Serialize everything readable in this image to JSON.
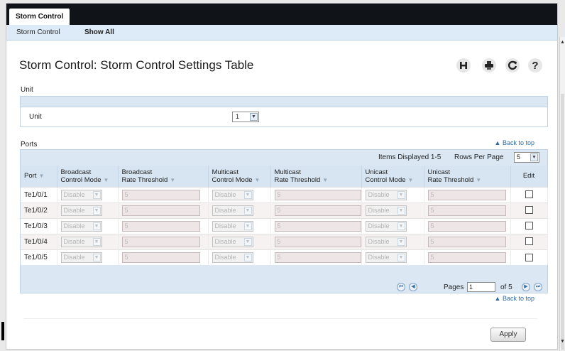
{
  "top_tab": "Storm Control",
  "subnav": {
    "items": [
      "Storm Control",
      "Show All"
    ]
  },
  "page_title": "Storm Control: Storm Control Settings Table",
  "icons": [
    "save-icon",
    "print-icon",
    "refresh-icon",
    "help-icon"
  ],
  "unit_section": {
    "label": "Unit",
    "row_label": "Unit",
    "selected": "1"
  },
  "ports_section": {
    "label": "Ports",
    "back_to_top": "Back to top",
    "items_displayed": "Items Displayed 1-5",
    "rows_per_page_label": "Rows Per Page",
    "rows_per_page": "5",
    "columns": {
      "port": "Port",
      "bc_mode": [
        "Broadcast",
        "Control Mode"
      ],
      "bc_rate": [
        "Broadcast",
        "Rate Threshold"
      ],
      "mc_mode": [
        "Multicast",
        "Control Mode"
      ],
      "mc_rate": [
        "Multicast",
        "Rate Threshold"
      ],
      "uc_mode": [
        "Unicast",
        "Control Mode"
      ],
      "uc_rate": [
        "Unicast",
        "Rate Threshold"
      ],
      "edit": "Edit"
    },
    "rows": [
      {
        "port": "Te1/0/1",
        "bc_mode": "Disable",
        "bc_rate": "5",
        "mc_mode": "Disable",
        "mc_rate": "5",
        "uc_mode": "Disable",
        "uc_rate": "5",
        "edit": false
      },
      {
        "port": "Te1/0/2",
        "bc_mode": "Disable",
        "bc_rate": "5",
        "mc_mode": "Disable",
        "mc_rate": "5",
        "uc_mode": "Disable",
        "uc_rate": "5",
        "edit": false
      },
      {
        "port": "Te1/0/3",
        "bc_mode": "Disable",
        "bc_rate": "5",
        "mc_mode": "Disable",
        "mc_rate": "5",
        "uc_mode": "Disable",
        "uc_rate": "5",
        "edit": false
      },
      {
        "port": "Te1/0/4",
        "bc_mode": "Disable",
        "bc_rate": "5",
        "mc_mode": "Disable",
        "mc_rate": "5",
        "uc_mode": "Disable",
        "uc_rate": "5",
        "edit": false
      },
      {
        "port": "Te1/0/5",
        "bc_mode": "Disable",
        "bc_rate": "5",
        "mc_mode": "Disable",
        "mc_rate": "5",
        "uc_mode": "Disable",
        "uc_rate": "5",
        "edit": false
      }
    ],
    "pager": {
      "pages_label": "Pages",
      "current_page": "1",
      "of_text": "of 5"
    }
  },
  "bottom_back_to_top": "Back to top",
  "apply_label": "Apply",
  "colors": {
    "tabbar": "#101418",
    "subnav": "#dcebf7",
    "table_header": "#d6e5f1",
    "link": "#2d6aa3"
  }
}
